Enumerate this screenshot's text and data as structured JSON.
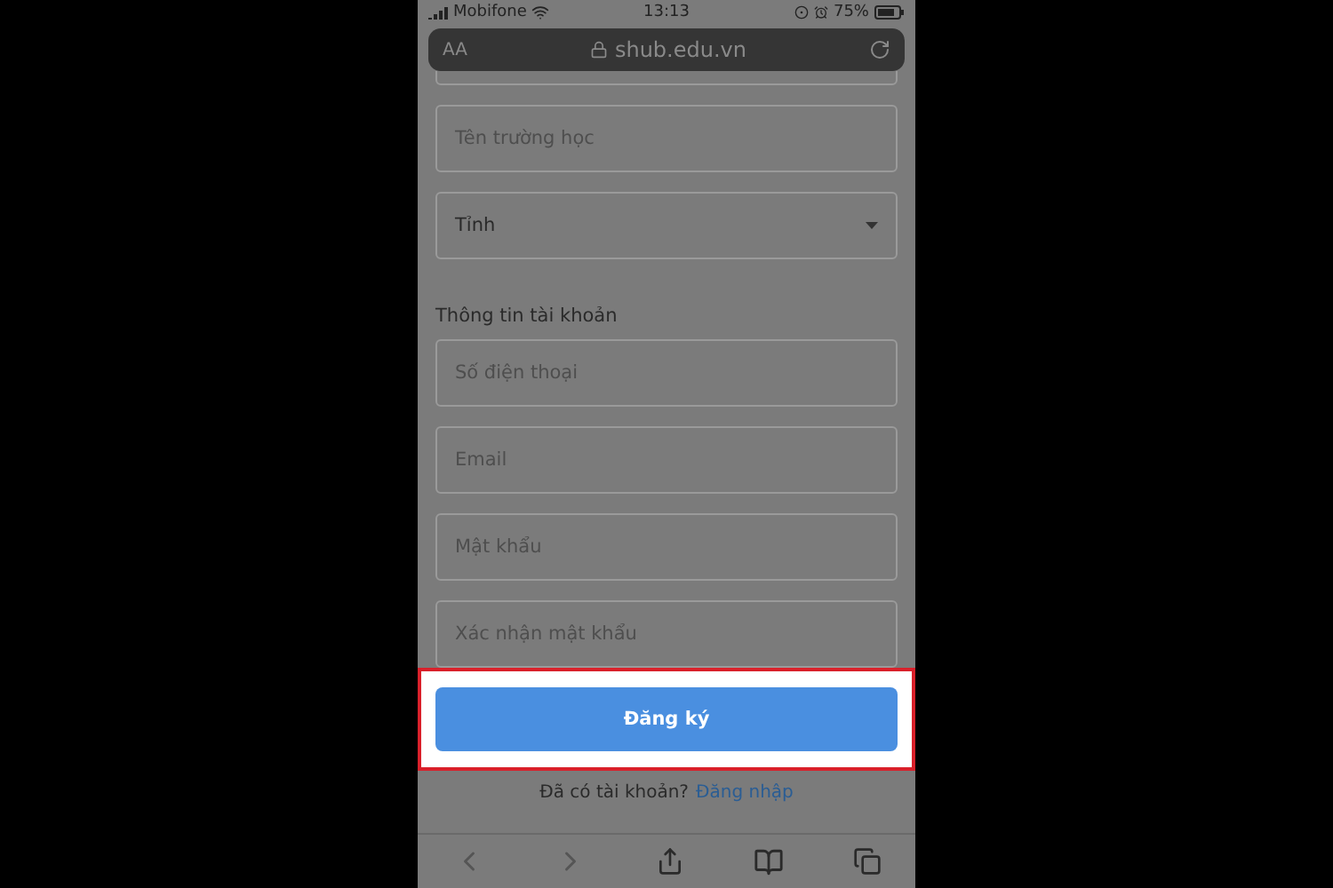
{
  "status_bar": {
    "carrier": "Mobifone",
    "time": "13:13",
    "battery": "75%"
  },
  "address_bar": {
    "text_size": "AA",
    "url": "shub.edu.vn"
  },
  "school_fields": [
    {
      "kind": "input",
      "placeholder": "Tên trường học"
    },
    {
      "kind": "select",
      "value": "Tỉnh"
    }
  ],
  "account_section": {
    "title": "Thông tin tài khoản",
    "fields": [
      {
        "kind": "input",
        "placeholder": "Số điện thoại"
      },
      {
        "kind": "input",
        "placeholder": "Email"
      },
      {
        "kind": "input",
        "placeholder": "Mật khẩu"
      },
      {
        "kind": "input",
        "placeholder": "Xác nhận mật khẩu"
      }
    ]
  },
  "submit_button": {
    "label": "Đăng ký",
    "highlighted": true
  },
  "login_prompt": {
    "text": "Đã có tài khoản?",
    "link": "Đăng nhập"
  }
}
